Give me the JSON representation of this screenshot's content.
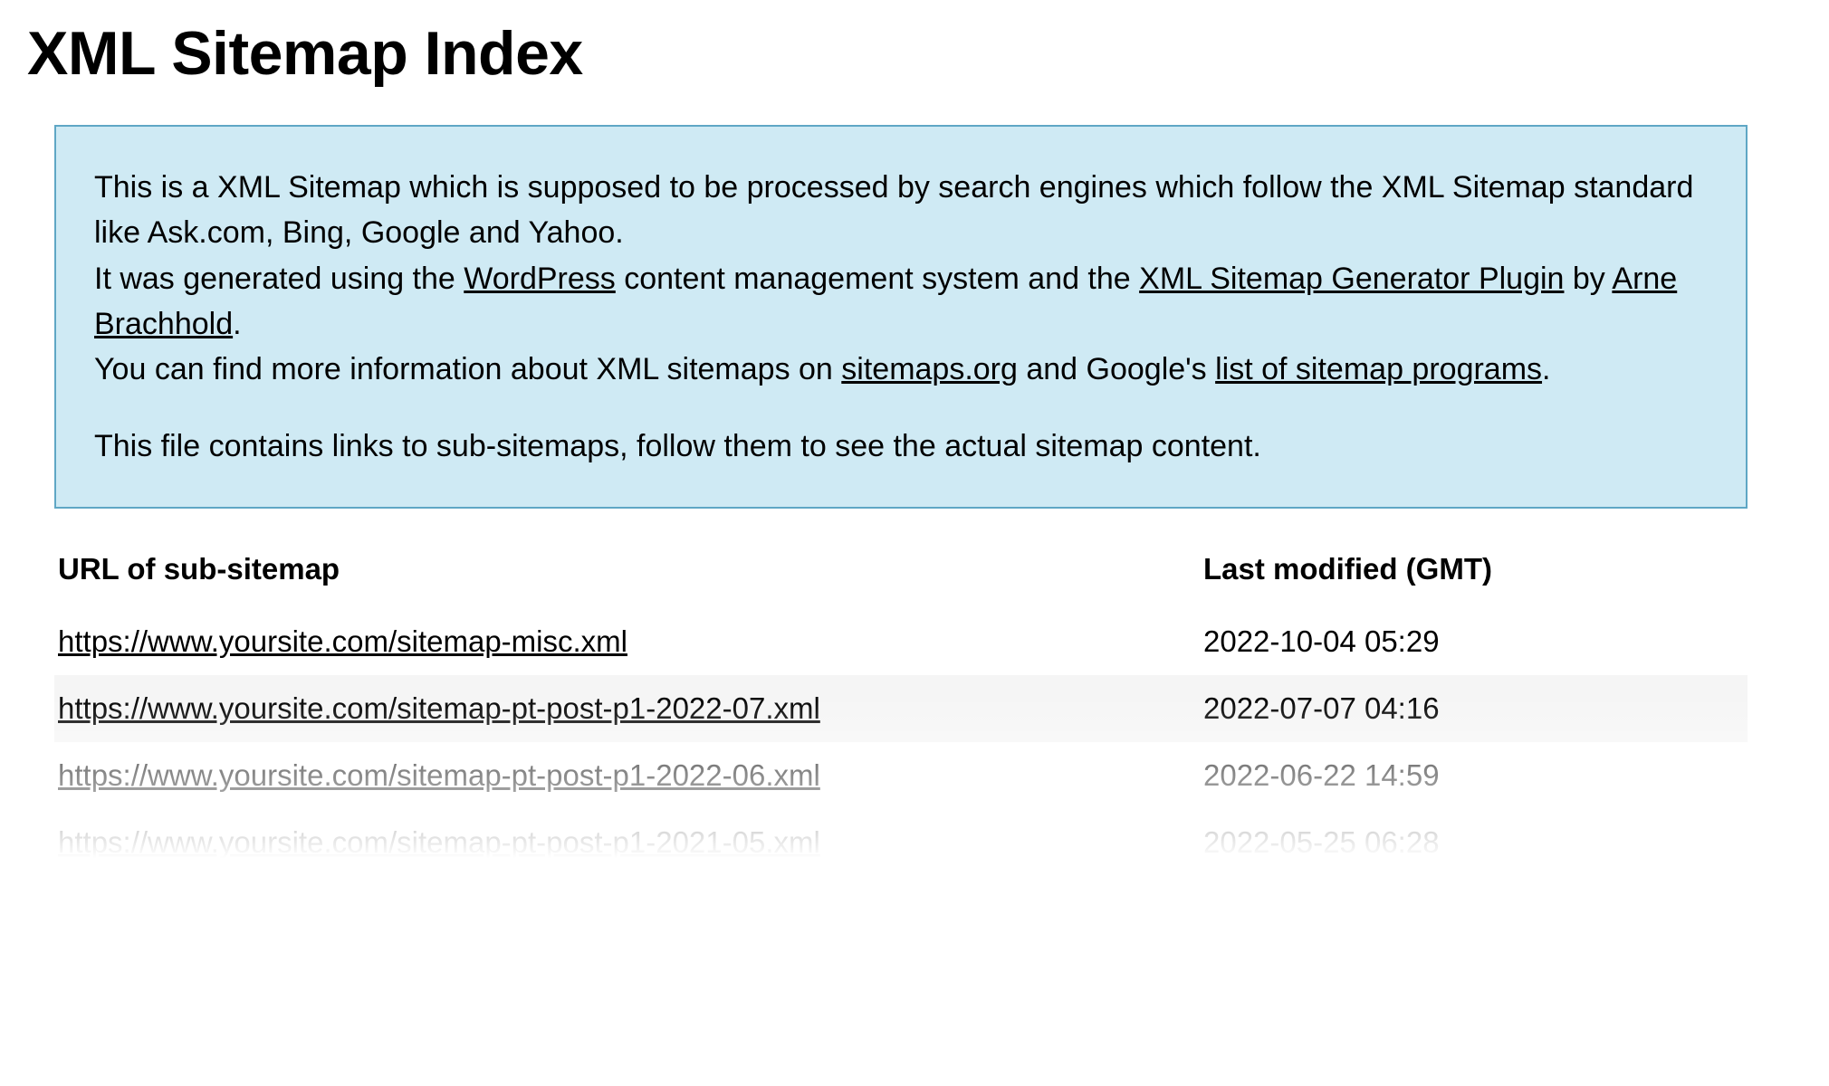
{
  "title": "XML Sitemap Index",
  "intro": {
    "line1_a": "This is a XML Sitemap which is supposed to be processed by search engines which follow the XML Sitemap standard like ",
    "link_ask": "Ask.com",
    "comma1": ", ",
    "link_bing": "Bing",
    "comma2": ", ",
    "link_google": "Google",
    "and1": " and ",
    "link_yahoo": "Yahoo",
    "line1_end": ".",
    "line2_a": "It was generated using the ",
    "link_wp": "WordPress",
    "line2_b": " content management system and the ",
    "link_plugin": "XML Sitemap Generator Plugin",
    "line2_by": " by ",
    "link_arne": "Arne Brachhold",
    "line2_end": ".",
    "line3_a": "You can find more information about XML sitemaps on ",
    "link_sitemaps": "sitemaps.org",
    "line3_b": " and Google's ",
    "link_list": "list of sitemap programs",
    "line3_end": ".",
    "para2": "This file contains links to sub-sitemaps, follow them to see the actual sitemap content."
  },
  "table": {
    "headers": {
      "url": "URL of sub-sitemap",
      "modified": "Last modified (GMT)"
    },
    "rows": [
      {
        "url": "https://www.yoursite.com/sitemap-misc.xml",
        "modified": "2022-10-04 05:29"
      },
      {
        "url": "https://www.yoursite.com/sitemap-pt-post-p1-2022-07.xml",
        "modified": "2022-07-07 04:16"
      },
      {
        "url": "https://www.yoursite.com/sitemap-pt-post-p1-2022-06.xml",
        "modified": "2022-06-22 14:59"
      },
      {
        "url": "https://www.yoursite.com/sitemap-pt-post-p1-2021-05.xml",
        "modified": "2022-05-25 06:28"
      }
    ]
  }
}
